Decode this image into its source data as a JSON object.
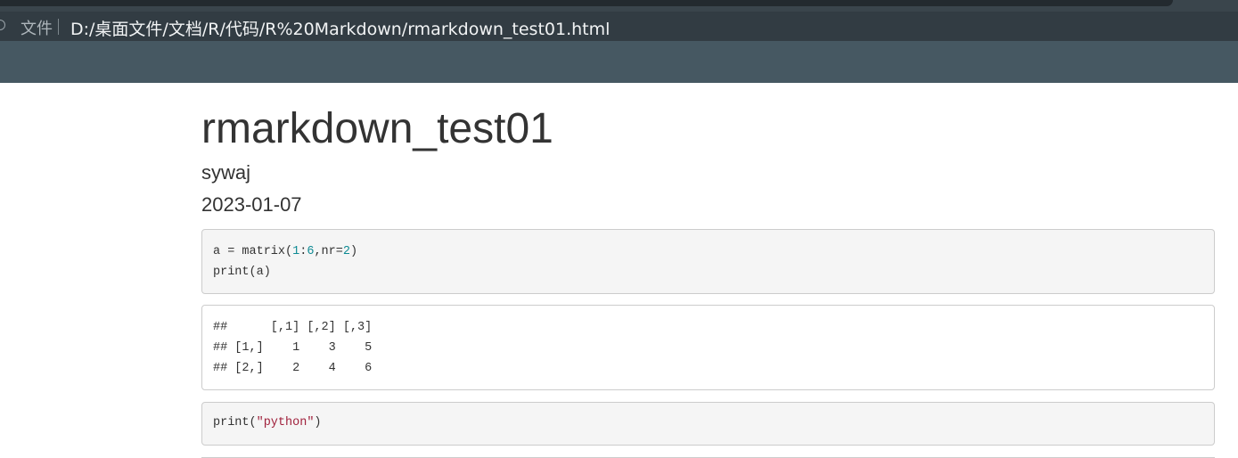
{
  "browser": {
    "file_label": "文件",
    "url": "D:/桌面文件/文档/R/代码/R%20Markdown/rmarkdown_test01.html",
    "info_icon": "info-icon"
  },
  "document": {
    "title": "rmarkdown_test01",
    "author": "sywaj",
    "date": "2023-01-07"
  },
  "code": {
    "chunk1": {
      "line1": {
        "a": "a = matrix(",
        "b": "1",
        "c": ":",
        "d": "6",
        "e": ",nr=",
        "f": "2",
        "g": ")"
      },
      "line2": "print(a)"
    },
    "output1": {
      "line1": "##      [,1] [,2] [,3]",
      "line2": "## [1,]    1    3    5",
      "line3": "## [2,]    2    4    6"
    },
    "chunk2": {
      "pre": "print(",
      "str": "\"python\"",
      "post": ")"
    }
  },
  "colors": {
    "chrome_dark": "#323c43",
    "bookmark_bar": "#465862",
    "number": "#0d8a93",
    "string": "#a0213c"
  }
}
